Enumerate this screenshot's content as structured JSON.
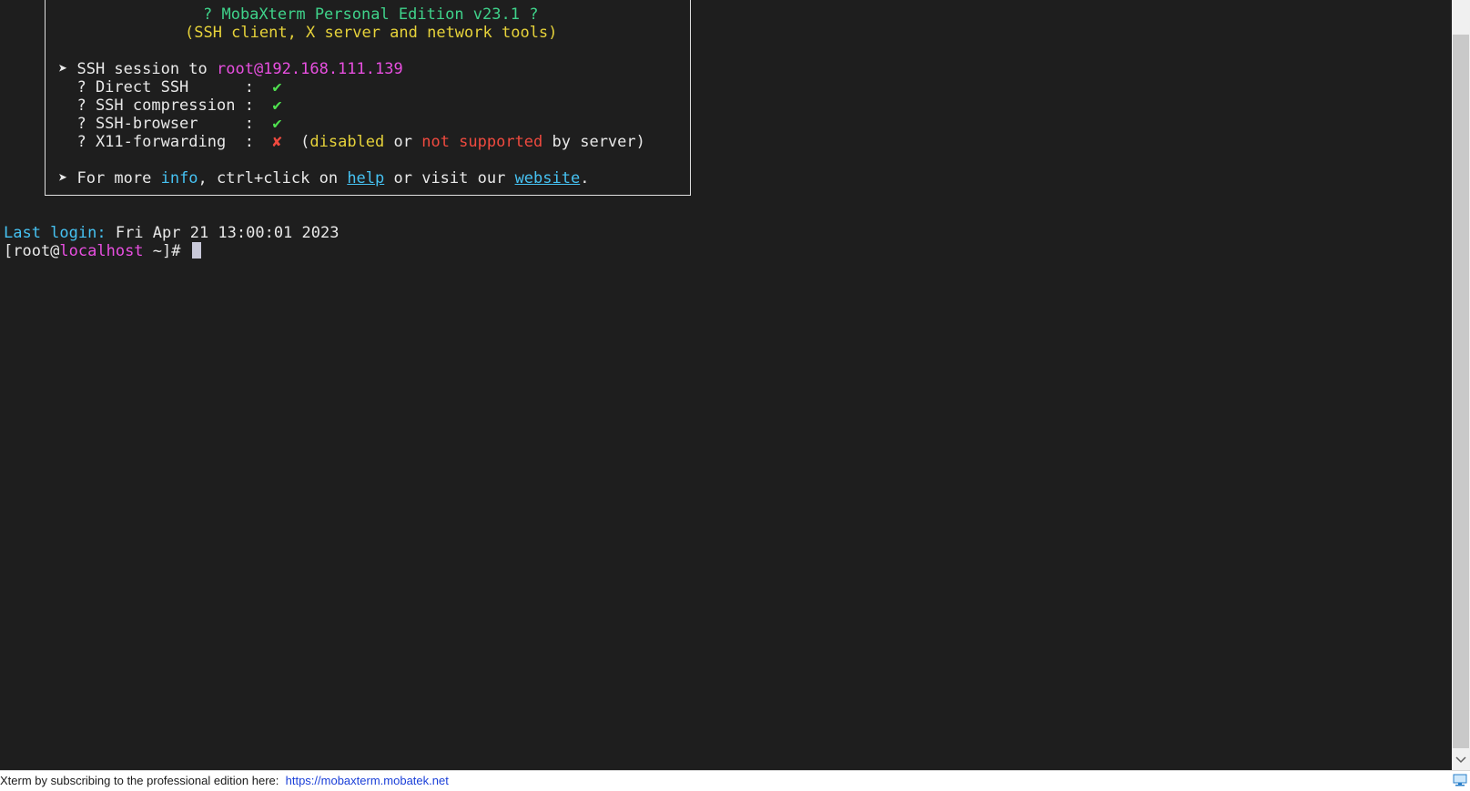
{
  "banner": {
    "title": "? MobaXterm Personal Edition v23.1 ?",
    "subtitle": "(SSH client, X server and network tools)",
    "session_prefix": "➤ SSH session to ",
    "session_target": "root@192.168.111.139",
    "features": [
      {
        "label": "  ? Direct SSH      :  ",
        "mark": "✔"
      },
      {
        "label": "  ? SSH compression :  ",
        "mark": "✔"
      },
      {
        "label": "  ? SSH-browser     :  ",
        "mark": "✔"
      },
      {
        "label": "  ? X11-forwarding  :  ",
        "mark": "✘"
      }
    ],
    "x11_note": {
      "open": "  (",
      "disabled": "disabled",
      "or": " or ",
      "not_supported": "not supported",
      "by_server": " by server)"
    },
    "info_line": {
      "prefix": "➤ For more ",
      "info": "info",
      "mid": ", ctrl+click on ",
      "help": "help",
      "or_visit": " or visit our ",
      "website": "website",
      "end": "."
    }
  },
  "terminal": {
    "last_login_label": "Last login:",
    "last_login_value": " Fri Apr 21 13:00:01 2023",
    "prompt_open": "[root@",
    "prompt_host": "localhost",
    "prompt_close": " ~]# "
  },
  "statusbar": {
    "text": "Xterm by subscribing to the professional edition here:  ",
    "link": "https://mobaxterm.mobatek.net"
  },
  "colors": {
    "terminal_bg": "#1e1e1e",
    "green": "#3fd28a",
    "yellow": "#e6d23a",
    "magenta": "#e84fe0",
    "red": "#ef4a3f",
    "cyan": "#46c2f2"
  },
  "icons": {
    "scroll_down": "chevron-down-icon",
    "status_monitor": "monitor-icon"
  }
}
